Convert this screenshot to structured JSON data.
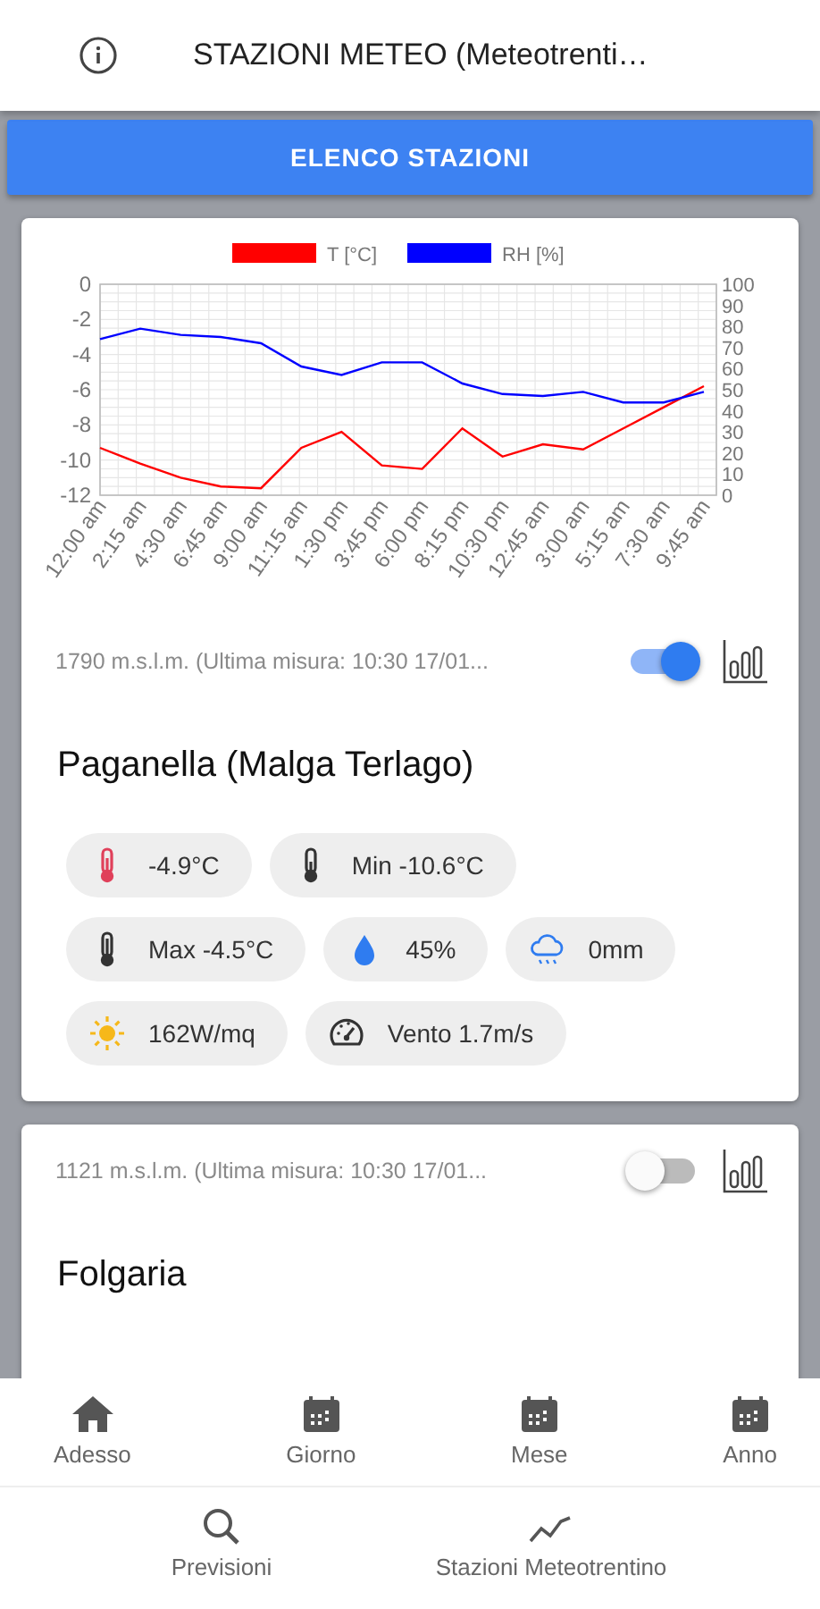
{
  "app_bar": {
    "title": "STAZIONI METEO (Meteotrenti…"
  },
  "list_button": {
    "label": "ELENCO STAZIONI"
  },
  "stations": [
    {
      "meta": "1790 m.s.l.m. (Ultima misura: 10:30 17/01...",
      "on": true,
      "name": "Paganella (Malga Terlago)",
      "chart_data": {
        "type": "line",
        "categories": [
          "12:00 am",
          "2:15 am",
          "4:30 am",
          "6:45 am",
          "9:00 am",
          "11:15 am",
          "1:30 pm",
          "3:45 pm",
          "6:00 pm",
          "8:15 pm",
          "10:30 pm",
          "12:45 am",
          "3:00 am",
          "5:15 am",
          "7:30 am",
          "9:45 am"
        ],
        "grid": true,
        "legend": true,
        "ylim": [
          -12,
          0
        ],
        "yticks": [
          0,
          -2,
          -4,
          -6,
          -8,
          -10,
          -12
        ],
        "y2lim": [
          0,
          100
        ],
        "y2ticks": [
          100,
          90,
          80,
          70,
          60,
          50,
          40,
          30,
          20,
          10,
          0
        ],
        "series": [
          {
            "name": "T [°C]",
            "color": "#ff0000",
            "values": [
              -9.3,
              -10.2,
              -11.0,
              -11.5,
              -11.6,
              -9.3,
              -8.4,
              -10.3,
              -10.5,
              -8.2,
              -9.8,
              -9.1,
              -9.4,
              -8.2,
              -7.0,
              -5.8
            ]
          },
          {
            "name": "RH [%]",
            "color": "#0000ff",
            "axis": "y2",
            "values": [
              74,
              79,
              76,
              75,
              72,
              61,
              57,
              63,
              63,
              53,
              48,
              47,
              49,
              44,
              44,
              49
            ]
          }
        ]
      },
      "chips": [
        {
          "kind": "temp",
          "text": "-4.9°C"
        },
        {
          "kind": "min",
          "text": "Min -10.6°C"
        },
        {
          "kind": "max",
          "text": "Max -4.5°C"
        },
        {
          "kind": "humidity",
          "text": "45%"
        },
        {
          "kind": "rain",
          "text": "0mm"
        },
        {
          "kind": "sun",
          "text": "162W/mq"
        },
        {
          "kind": "wind",
          "text": "Vento 1.7m/s"
        }
      ]
    },
    {
      "meta": "1121 m.s.l.m. (Ultima misura: 10:30 17/01...",
      "on": false,
      "name": "Folgaria"
    }
  ],
  "nav_top": [
    {
      "kind": "home",
      "label": "Adesso"
    },
    {
      "kind": "calendar",
      "label": "Giorno"
    },
    {
      "kind": "calendar",
      "label": "Mese"
    },
    {
      "kind": "calendar",
      "label": "Anno"
    }
  ],
  "nav_bottom": [
    {
      "kind": "search",
      "label": "Previsioni"
    },
    {
      "kind": "trend",
      "label": "Stazioni Meteotrentino"
    }
  ]
}
